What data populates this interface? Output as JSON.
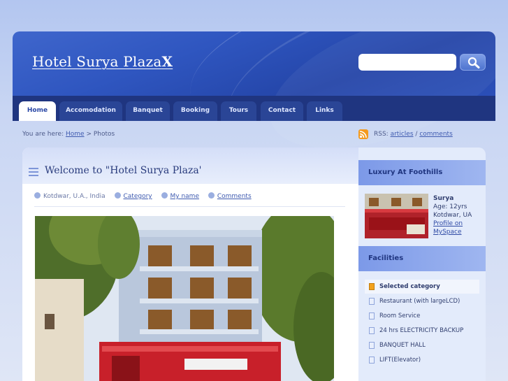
{
  "header": {
    "title": "Hotel Surya Plaza",
    "title_suffix": "X",
    "search_placeholder": ""
  },
  "nav": {
    "tabs": [
      {
        "label": "Home",
        "active": true
      },
      {
        "label": "Accomodation",
        "active": false
      },
      {
        "label": "Banquet",
        "active": false
      },
      {
        "label": "Booking",
        "active": false
      },
      {
        "label": "Tours",
        "active": false
      },
      {
        "label": "Contact",
        "active": false
      },
      {
        "label": "Links",
        "active": false
      }
    ]
  },
  "breadcrumb": {
    "prefix": "You are here:",
    "home": "Home",
    "sep": ">",
    "current": "Photos"
  },
  "rss": {
    "label": "RSS:",
    "articles": "articles",
    "sep": "/",
    "comments": "comments"
  },
  "post": {
    "title": "Welcome to \"Hotel Surya Plaza'",
    "location": "Kotdwar, U.A., India",
    "category": "Category",
    "author": "My name",
    "comments": "Comments"
  },
  "sidebar": {
    "heading1": "Luxury At Foothills",
    "profile": {
      "name": "Surya",
      "age": "Age: 12yrs",
      "place": "Kotdwar, UA",
      "link": "Profile on MySpace"
    },
    "heading2": "Facilities",
    "facilities": [
      {
        "label": "Selected category",
        "selected": true
      },
      {
        "label": "Restaurant (with largeLCD)",
        "selected": false
      },
      {
        "label": "Room Service",
        "selected": false
      },
      {
        "label": "24 hrs ELECTRICITY BACKUP",
        "selected": false
      },
      {
        "label": "BANQUET HALL",
        "selected": false
      },
      {
        "label": "LIFT(Elevator)",
        "selected": false
      }
    ]
  },
  "colors": {
    "header": "#2f56c0",
    "nav": "#1f3580",
    "accent": "#3f5bb0",
    "rss": "#f39a1e"
  }
}
